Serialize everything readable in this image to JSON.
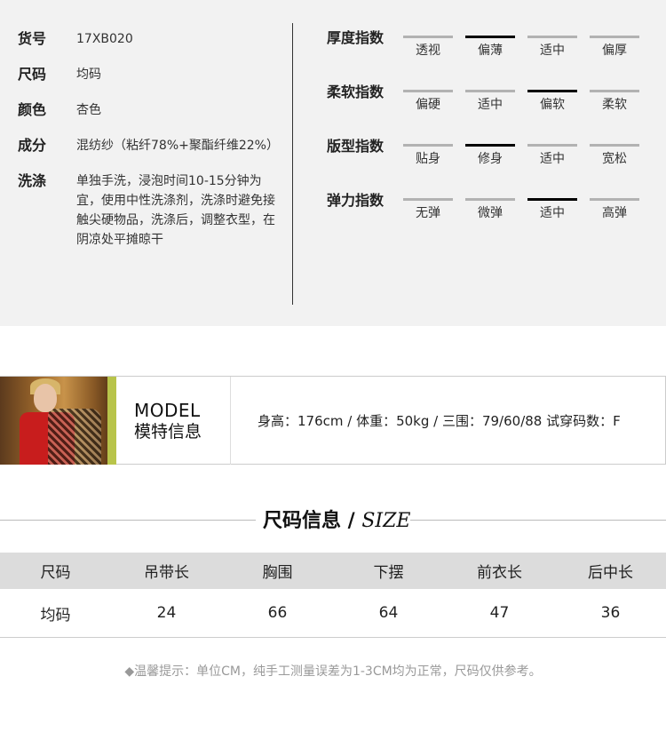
{
  "specs": [
    {
      "label": "货号",
      "value": "17XB020"
    },
    {
      "label": "尺码",
      "value": "均码"
    },
    {
      "label": "颜色",
      "value": "杏色"
    },
    {
      "label": "成分",
      "value": "混纺纱（粘纤78%+聚酯纤维22%）"
    },
    {
      "label": "洗涤",
      "value": "单独手洗，浸泡时间10-15分钟为宜，使用中性洗涤剂，洗涤时避免接触尖硬物品，洗涤后，调整衣型，在阴凉处平摊晾干"
    }
  ],
  "scales": [
    {
      "title": "厚度指数",
      "options": [
        "透视",
        "偏薄",
        "适中",
        "偏厚"
      ],
      "selected": "偏薄"
    },
    {
      "title": "柔软指数",
      "options": [
        "偏硬",
        "适中",
        "偏软",
        "柔软"
      ],
      "selected": "偏软"
    },
    {
      "title": "版型指数",
      "options": [
        "贴身",
        "修身",
        "适中",
        "宽松"
      ],
      "selected": "修身"
    },
    {
      "title": "弹力指数",
      "options": [
        "无弹",
        "微弹",
        "适中",
        "高弹"
      ],
      "selected": "适中"
    }
  ],
  "colors": {
    "panel_bg": "#f2f2f2",
    "scale_active": "#000000",
    "scale_inactive": "#b2b2b2",
    "table_header_bg": "#dcdcdc",
    "tip_text": "#999999"
  },
  "model": {
    "title_en": "MODEL",
    "title_cn": "模特信息",
    "info": "身高：176cm / 体重：50kg / 三围：79/60/88 试穿码数：F"
  },
  "size_section": {
    "title_cn": "尺码信息 / ",
    "title_en": "SIZE",
    "headers": [
      "尺码",
      "吊带长",
      "胸围",
      "下摆",
      "前衣长",
      "后中长"
    ],
    "rows": [
      [
        "均码",
        "24",
        "66",
        "64",
        "47",
        "36"
      ]
    ]
  },
  "tip": {
    "mark": "◆",
    "text": "温馨提示：单位CM，纯手工测量误差为1-3CM均为正常，尺码仅供参考。"
  }
}
